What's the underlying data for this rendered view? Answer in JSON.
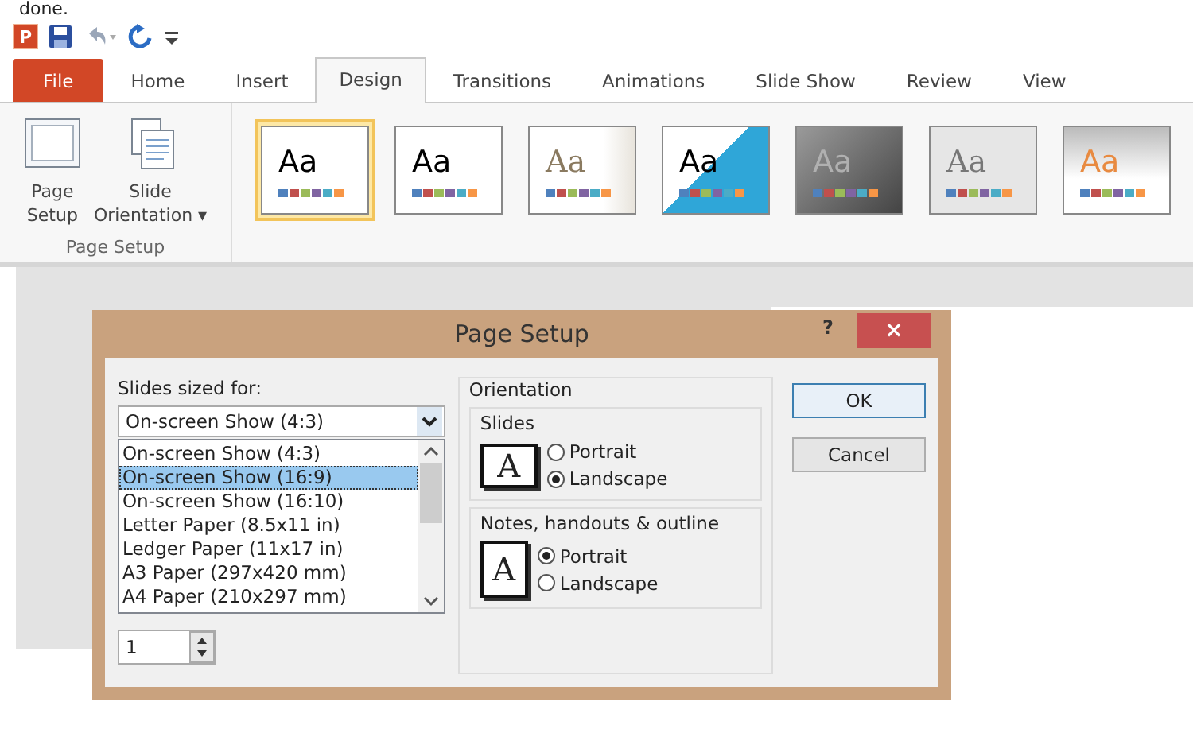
{
  "caption": "done.",
  "quick_access": {
    "logo": "P"
  },
  "tabs": [
    {
      "label": "File",
      "kind": "file",
      "selected": false
    },
    {
      "label": "Home",
      "kind": "tab",
      "selected": false
    },
    {
      "label": "Insert",
      "kind": "tab",
      "selected": false
    },
    {
      "label": "Design",
      "kind": "tab",
      "selected": true
    },
    {
      "label": "Transitions",
      "kind": "tab",
      "selected": false
    },
    {
      "label": "Animations",
      "kind": "tab",
      "selected": false
    },
    {
      "label": "Slide Show",
      "kind": "tab",
      "selected": false
    },
    {
      "label": "Review",
      "kind": "tab",
      "selected": false
    },
    {
      "label": "View",
      "kind": "tab",
      "selected": false
    }
  ],
  "ribbon": {
    "group_label": "Page Setup",
    "buttons": [
      {
        "kind": "page-setup",
        "lines": [
          "Page",
          "Setup"
        ]
      },
      {
        "kind": "orientation",
        "lines": [
          "Slide",
          "Orientation ▾"
        ]
      }
    ],
    "themes": [
      {
        "label": "Aa",
        "selected": true
      },
      {
        "label": "Aa",
        "selected": false
      },
      {
        "label": "Aa",
        "selected": false
      },
      {
        "label": "Aa",
        "selected": false
      },
      {
        "label": "Aa",
        "selected": false
      },
      {
        "label": "Aa",
        "selected": false
      },
      {
        "label": "Aa",
        "selected": false
      }
    ]
  },
  "dialog": {
    "title": "Page Setup",
    "help": "?",
    "close": "×",
    "sized_for_label": "Slides sized for:",
    "combo_value": "On-screen Show (4:3)",
    "options": [
      {
        "label": "On-screen Show (4:3)",
        "selected": false
      },
      {
        "label": "On-screen Show (16:9)",
        "selected": true
      },
      {
        "label": "On-screen Show (16:10)",
        "selected": false
      },
      {
        "label": "Letter Paper (8.5x11 in)",
        "selected": false
      },
      {
        "label": "Ledger Paper (11x17 in)",
        "selected": false
      },
      {
        "label": "A3 Paper (297x420 mm)",
        "selected": false
      },
      {
        "label": "A4 Paper (210x297 mm)",
        "selected": false
      }
    ],
    "spinner_value": "1",
    "orientation_label": "Orientation",
    "groups": [
      {
        "title": "Slides",
        "glyph": "A",
        "options": [
          {
            "label": "Portrait",
            "selected": false
          },
          {
            "label": "Landscape",
            "selected": true
          }
        ]
      },
      {
        "title": "Notes, handouts & outline",
        "glyph": "A",
        "options": [
          {
            "label": "Portrait",
            "selected": true
          },
          {
            "label": "Landscape",
            "selected": false
          }
        ]
      }
    ],
    "buttons": [
      {
        "label": "OK",
        "kind": "default"
      },
      {
        "label": "Cancel",
        "kind": "normal"
      }
    ]
  }
}
